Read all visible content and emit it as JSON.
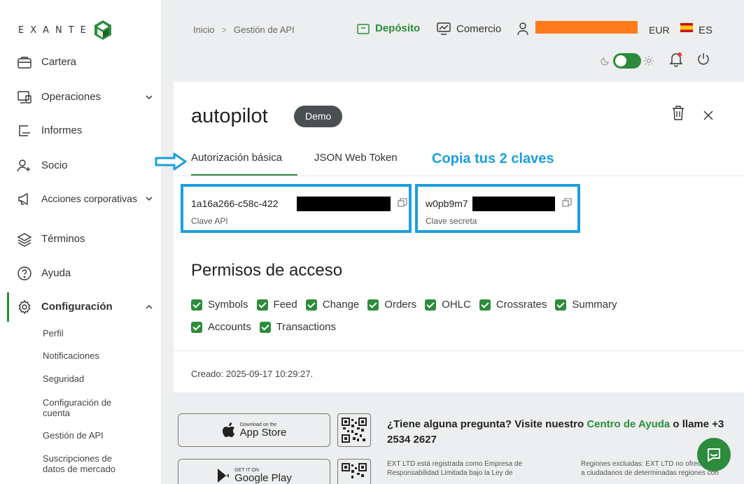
{
  "brand": {
    "logo_text": "EXANTE"
  },
  "sidebar": {
    "items": [
      {
        "label": "Cartera",
        "icon": "briefcase-icon"
      },
      {
        "label": "Operaciones",
        "icon": "monitor-icon"
      },
      {
        "label": "Informes",
        "icon": "report-icon"
      },
      {
        "label": "Socio",
        "icon": "add-user-icon"
      },
      {
        "label": "Acciones corporativas",
        "icon": "megaphone-icon"
      },
      {
        "label": "Términos",
        "icon": "layers-icon"
      },
      {
        "label": "Ayuda",
        "icon": "help-icon"
      },
      {
        "label": "Configuración",
        "icon": "gear-icon"
      }
    ],
    "subitems": [
      "Perfil",
      "Notificaciones",
      "Seguridad",
      "Configuración de cuenta",
      "Gestión de API",
      "Suscripciones de datos de mercado"
    ]
  },
  "header": {
    "breadcrumb": [
      "Inicio",
      "Gestión de API"
    ],
    "deposit": "Depósito",
    "trade": "Comercio",
    "currency": "EUR",
    "language": "ES"
  },
  "card": {
    "title": "autopilot",
    "badge": "Demo",
    "tabs": [
      "Autorización básica",
      "JSON Web Token"
    ],
    "annotation": "Copia tus 2 claves",
    "api_key": {
      "value": "1a16a266-c58c-422",
      "label": "Clave API"
    },
    "secret_key": {
      "value": "w0pb9m7",
      "label": "Clave secreta"
    },
    "permissions_title": "Permisos de acceso",
    "permissions_row1": [
      "Symbols",
      "Feed",
      "Change",
      "Orders",
      "OHLC",
      "Crossrates",
      "Summary"
    ],
    "permissions_row2": [
      "Accounts",
      "Transactions"
    ],
    "created": "Creado: 2025-09-17 10:29:27."
  },
  "footer": {
    "appstore_small": "Download on the",
    "appstore_big": "App Store",
    "gplay_small": "GET IT ON",
    "gplay_big": "Google Play",
    "question_a": "¿Tiene alguna pregunta? Visite nuestro ",
    "question_help": "Centro de Ayuda",
    "question_b": " o llame +3",
    "phone": "2534 2627",
    "legal_1": "EXT LTD está registrada como Empresa de",
    "legal_2": "Responsabilidad Limitada bajo la Ley de",
    "regions_1": "Regiones excluidas: EXT LTD no ofrece servi",
    "regions_2": "a ciudadanos de determinadas regiones con"
  },
  "colors": {
    "accent": "#2c8c3c",
    "annotation": "#1c9ee0",
    "redaction_orange": "#ff7a1a"
  }
}
